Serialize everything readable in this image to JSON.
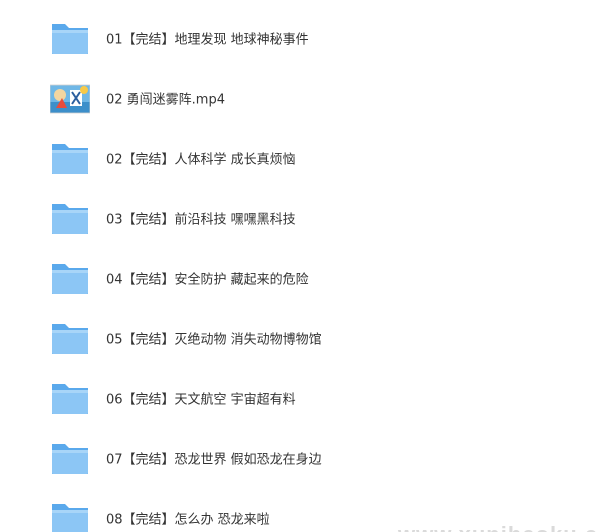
{
  "files": [
    {
      "name": "01【完结】地理发现 地球神秘事件",
      "icon": "folder-icon"
    },
    {
      "name": "02 勇闯迷雾阵.mp4",
      "icon": "video-thumbnail-icon"
    },
    {
      "name": "02【完结】人体科学 成长真烦恼",
      "icon": "folder-icon"
    },
    {
      "name": "03【完结】前沿科技 嘿嘿黑科技",
      "icon": "folder-icon"
    },
    {
      "name": "04【完结】安全防护 藏起来的危险",
      "icon": "folder-icon"
    },
    {
      "name": "05【完结】灭绝动物 消失动物博物馆",
      "icon": "folder-icon"
    },
    {
      "name": "06【完结】天文航空 宇宙超有料",
      "icon": "folder-icon"
    },
    {
      "name": "07【完结】恐龙世界 假如恐龙在身边",
      "icon": "folder-icon"
    },
    {
      "name": "08【完结】怎么办 恐龙来啦",
      "icon": "folder-icon"
    }
  ],
  "watermark": "www.xuniheoku.com",
  "colors": {
    "folder_front": "#8cc6f5",
    "folder_back": "#5aa9ec",
    "text": "#333333"
  }
}
